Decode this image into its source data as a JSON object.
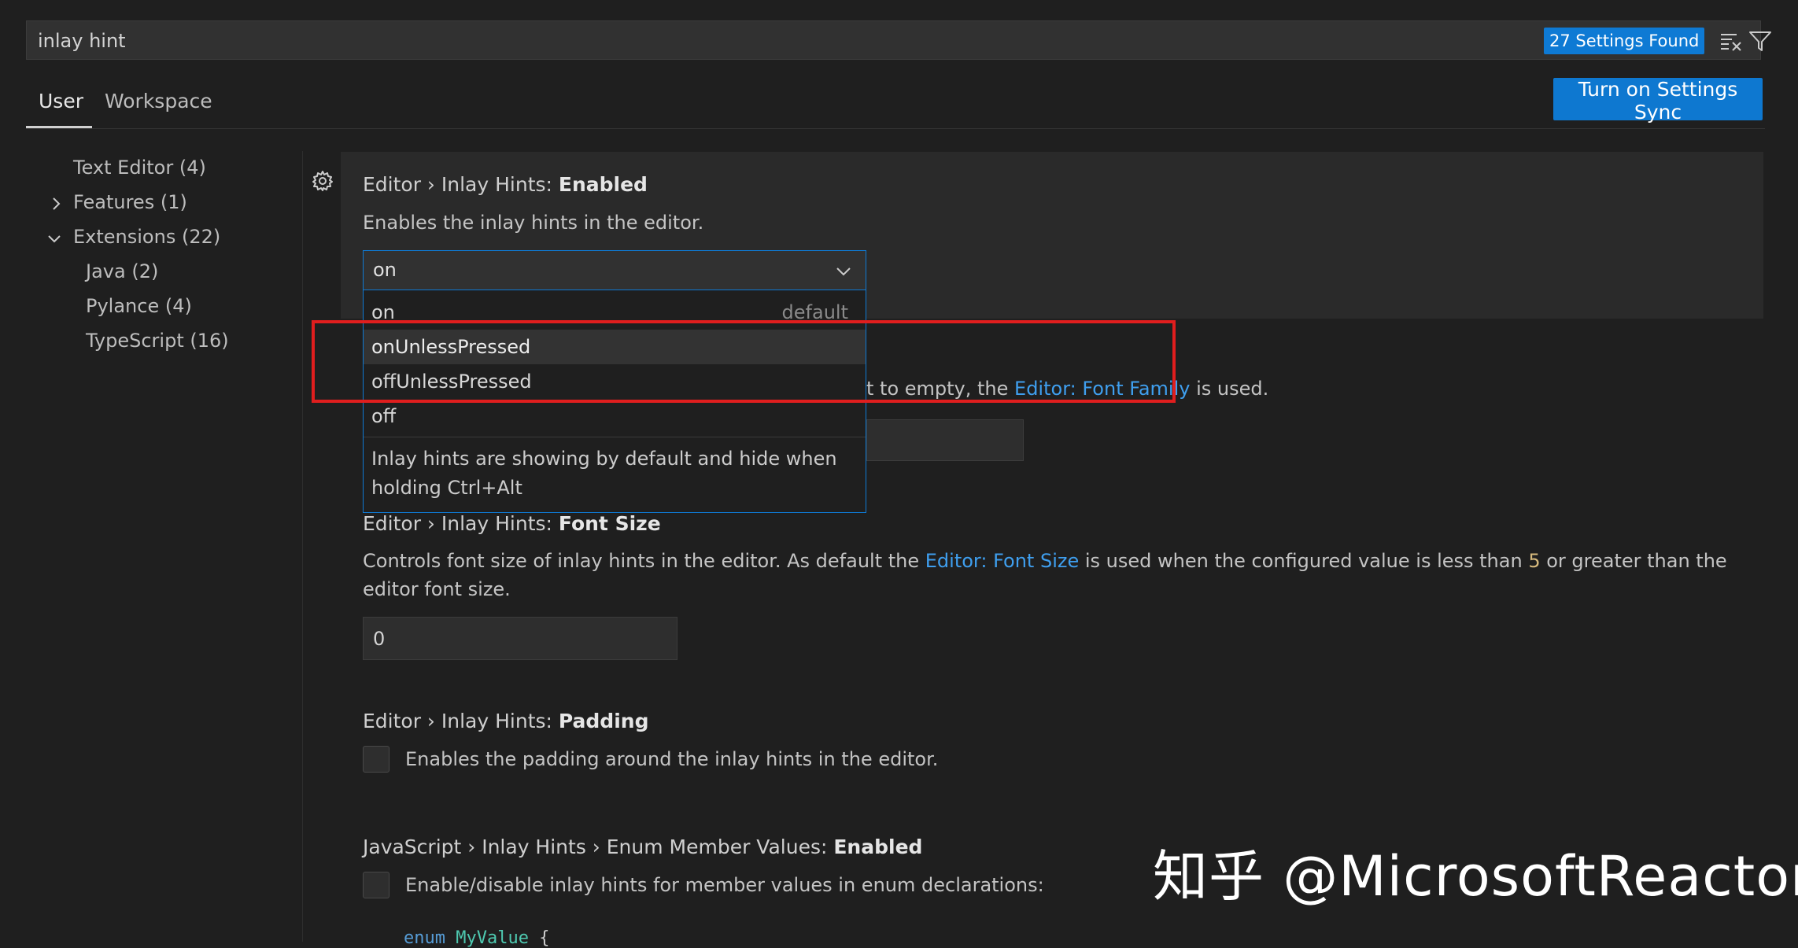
{
  "search": {
    "value": "inlay hint",
    "results_badge": "27 Settings Found",
    "clear_icon": "clear-filter-icon",
    "filter_icon": "filter-icon"
  },
  "tabs": [
    {
      "label": "User",
      "active": true
    },
    {
      "label": "Workspace",
      "active": false
    }
  ],
  "sync_button": "Turn on Settings Sync",
  "toc": [
    {
      "label": "Text Editor (4)",
      "chevron": "none"
    },
    {
      "label": "Features (1)",
      "chevron": "chevron-right-icon"
    },
    {
      "label": "Extensions (22)",
      "chevron": "chevron-down-icon"
    },
    {
      "label": "Java (2)",
      "chevron": "none"
    },
    {
      "label": "Pylance (4)",
      "chevron": "none"
    },
    {
      "label": "TypeScript (16)",
      "chevron": "none"
    }
  ],
  "settings": {
    "enabled": {
      "category": "Editor › Inlay Hints: ",
      "name": "Enabled",
      "description": "Enables the inlay hints in the editor.",
      "value": "on",
      "options": [
        {
          "label": "on",
          "tag": "default"
        },
        {
          "label": "onUnlessPressed"
        },
        {
          "label": "offUnlessPressed"
        },
        {
          "label": "off"
        }
      ],
      "option_description": "Inlay hints are showing by default and hide when holding Ctrl+Alt"
    },
    "font_family": {
      "desc_fragment_before": "t to empty, the ",
      "link": "Editor: Font Family",
      "desc_fragment_after": " is used."
    },
    "font_size": {
      "category": "Editor › Inlay Hints: ",
      "name": "Font Size",
      "desc_part1": "Controls font size of inlay hints in the editor. As default the ",
      "link": "Editor: Font Size",
      "desc_part2": " is used when the configured value is less than ",
      "number": "5",
      "desc_part3": " or greater than the editor font size.",
      "value": "0"
    },
    "padding": {
      "category": "Editor › Inlay Hints: ",
      "name": "Padding",
      "description": "Enables the padding around the inlay hints in the editor."
    },
    "enum_member": {
      "category": "JavaScript › Inlay Hints › Enum Member Values: ",
      "name": "Enabled",
      "description": "Enable/disable inlay hints for member values in enum declarations:",
      "code_keyword": "enum",
      "code_name": "MyValue",
      "code_brace": "{"
    }
  },
  "watermark": "知乎 @MicrosoftReactor",
  "colors": {
    "accent": "#0e7ad4",
    "link": "#3f9fef",
    "highlight_box": "#e01e1e",
    "background": "#1f1f1f"
  }
}
